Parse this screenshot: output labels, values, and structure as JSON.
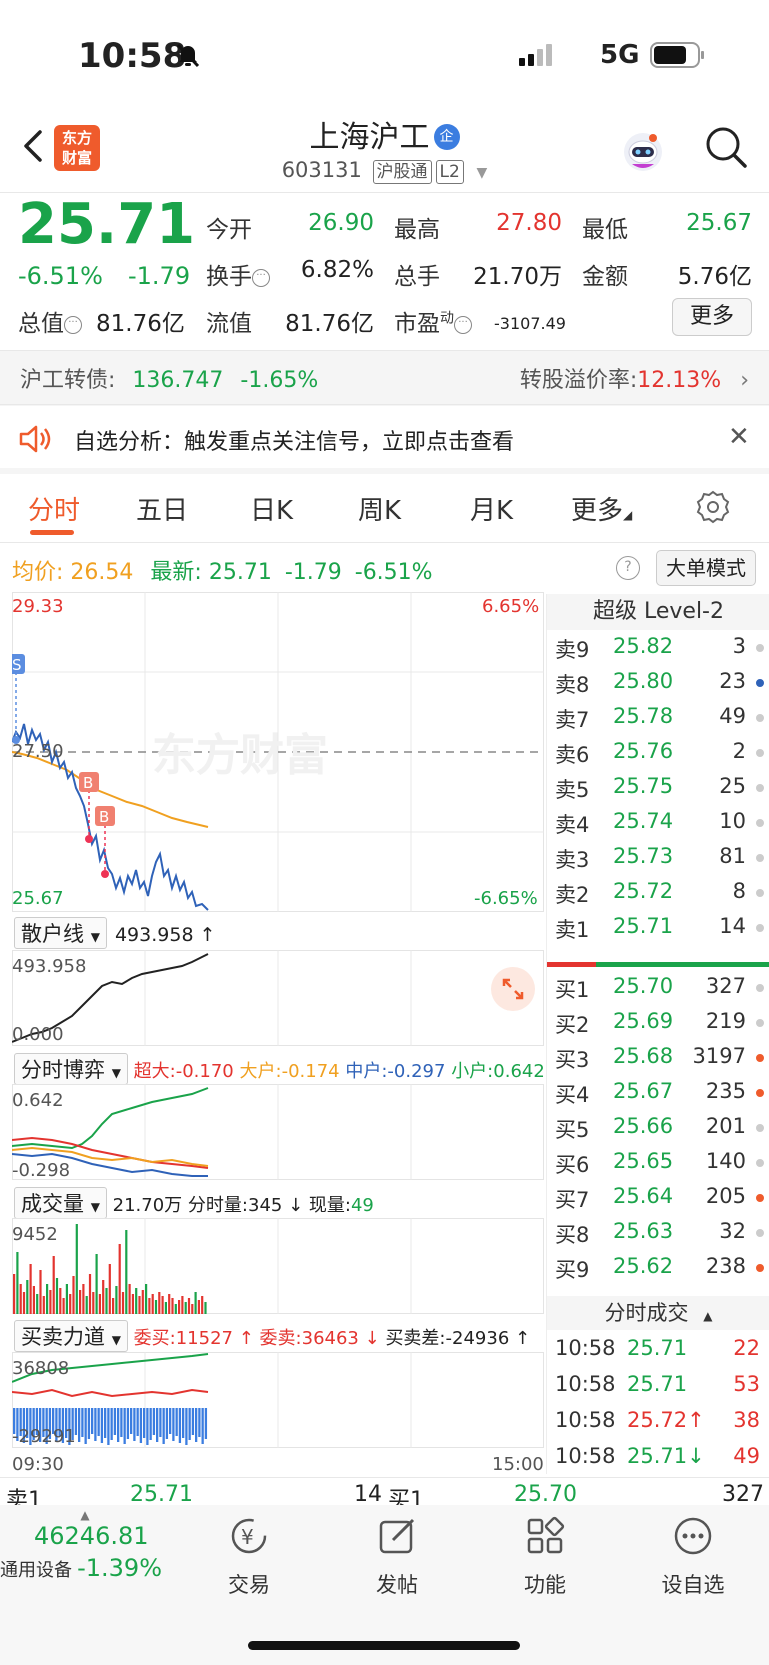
{
  "status_bar": {
    "time": "10:58",
    "network": "5G"
  },
  "header": {
    "logo_line1": "东方",
    "logo_line2": "财富",
    "title": "上海沪工",
    "title_badge": "企",
    "code": "603131",
    "tag1": "沪股通",
    "tag2": "L2"
  },
  "quote": {
    "price": "25.71",
    "change_pct": "-6.51%",
    "change": "-1.79",
    "open_label": "今开",
    "open": "26.90",
    "high_label": "最高",
    "high": "27.80",
    "low_label": "最低",
    "low": "25.67",
    "turnover_label": "换手",
    "turnover": "6.82%",
    "volume_label": "总手",
    "volume": "21.70万",
    "amount_label": "金额",
    "amount": "5.76亿",
    "mktcap_label": "总值",
    "mktcap": "81.76亿",
    "float_label": "流值",
    "float": "81.76亿",
    "pe_label": "市盈",
    "pe_sup": "动",
    "pe": "-3107.49",
    "more_button": "更多"
  },
  "bond": {
    "label": "沪工转债:",
    "price": "136.747",
    "change": "-1.65%",
    "premium_label": "转股溢价率:",
    "premium": "12.13%"
  },
  "alert": {
    "text": "自选分析：触发重点关注信号，立即点击查看"
  },
  "tabs": [
    "分时",
    "五日",
    "日K",
    "周K",
    "月K",
    "更多"
  ],
  "info_row": {
    "avg_label": "均价:",
    "avg": "26.54",
    "latest_label": "最新:",
    "latest": "25.71",
    "change": "-1.79",
    "change_pct": "-6.51%",
    "big_order_button": "大单模式"
  },
  "main_chart": {
    "top_price": "29.33",
    "top_pct": "6.65%",
    "mid_price": "27.50",
    "bottom_price": "25.67",
    "bottom_pct": "-6.65%",
    "watermark": "东方财富",
    "marker_s": "S",
    "marker_b": "B"
  },
  "retail_line": {
    "select": "散户线",
    "value": "493.958 ↑",
    "axis_top": "493.958",
    "axis_bottom": "0.000"
  },
  "game_panel": {
    "select": "分时博弈",
    "super_label": "超大:",
    "super": "-0.170",
    "large_label": "大户:",
    "large": "-0.174",
    "mid_label": "中户:",
    "mid": "-0.297",
    "small_label": "小户:",
    "small": "0.642",
    "axis_top": "0.642",
    "axis_bottom": "-0.298"
  },
  "volume_panel": {
    "select": "成交量",
    "total": "21.70万",
    "period_label": "分时量:",
    "period": "345 ↓",
    "now_label": "现量:",
    "now": "49",
    "axis_top": "9452"
  },
  "force_panel": {
    "select": "买卖力道",
    "buy_label": "委买:",
    "buy": "11527 ↑",
    "sell_label": "委卖:",
    "sell": "36463 ↓",
    "diff_label": "买卖差:",
    "diff": "-24936 ↑",
    "axis_top": "36808",
    "axis_bottom": "-29291",
    "time_start": "09:30",
    "time_end": "15:00"
  },
  "order_book": {
    "title": "超级 Level-2",
    "asks": [
      {
        "label": "卖9",
        "price": "25.82",
        "vol": "3",
        "dot": "#cccccc"
      },
      {
        "label": "卖8",
        "price": "25.80",
        "vol": "23",
        "dot": "#2f62b8"
      },
      {
        "label": "卖7",
        "price": "25.78",
        "vol": "49",
        "dot": "#cccccc"
      },
      {
        "label": "卖6",
        "price": "25.76",
        "vol": "2",
        "dot": "#cccccc"
      },
      {
        "label": "卖5",
        "price": "25.75",
        "vol": "25",
        "dot": "#cccccc"
      },
      {
        "label": "卖4",
        "price": "25.74",
        "vol": "10",
        "dot": "#cccccc"
      },
      {
        "label": "卖3",
        "price": "25.73",
        "vol": "81",
        "dot": "#cccccc"
      },
      {
        "label": "卖2",
        "price": "25.72",
        "vol": "8",
        "dot": "#cccccc"
      },
      {
        "label": "卖1",
        "price": "25.71",
        "vol": "14",
        "dot": "#cccccc"
      }
    ],
    "bids": [
      {
        "label": "买1",
        "price": "25.70",
        "vol": "327",
        "dot": "#cccccc"
      },
      {
        "label": "买2",
        "price": "25.69",
        "vol": "219",
        "dot": "#cccccc"
      },
      {
        "label": "买3",
        "price": "25.68",
        "vol": "3197",
        "dot": "#ef5b2c"
      },
      {
        "label": "买4",
        "price": "25.67",
        "vol": "235",
        "dot": "#ef5b2c"
      },
      {
        "label": "买5",
        "price": "25.66",
        "vol": "201",
        "dot": "#cccccc"
      },
      {
        "label": "买6",
        "price": "25.65",
        "vol": "140",
        "dot": "#cccccc"
      },
      {
        "label": "买7",
        "price": "25.64",
        "vol": "205",
        "dot": "#ef5b2c"
      },
      {
        "label": "买8",
        "price": "25.63",
        "vol": "32",
        "dot": "#cccccc"
      },
      {
        "label": "买9",
        "price": "25.62",
        "vol": "238",
        "dot": "#ef5b2c"
      }
    ],
    "ticks_title": "分时成交",
    "ticks": [
      {
        "time": "10:58",
        "price": "25.71",
        "vol": "22"
      },
      {
        "time": "10:58",
        "price": "25.71",
        "vol": "53"
      },
      {
        "time": "10:58",
        "price": "25.72↑",
        "vol": "38"
      },
      {
        "time": "10:58",
        "price": "25.71↓",
        "vol": "49"
      }
    ]
  },
  "level1": {
    "ask_label": "卖1",
    "ask_price": "25.71",
    "ask_vol": "14",
    "bid_label": "买1",
    "bid_price": "25.70",
    "bid_vol": "327"
  },
  "bottom_nav": {
    "index_value": "46246.81",
    "index_name": "通用设备",
    "index_change": "-1.39%",
    "items": [
      "交易",
      "发帖",
      "功能",
      "设自选"
    ]
  },
  "colors": {
    "up": "#e3342f",
    "down": "#1aa34a",
    "accent": "#ef5b2c",
    "avg_line": "#f0a020",
    "price_line": "#2f62b8"
  }
}
